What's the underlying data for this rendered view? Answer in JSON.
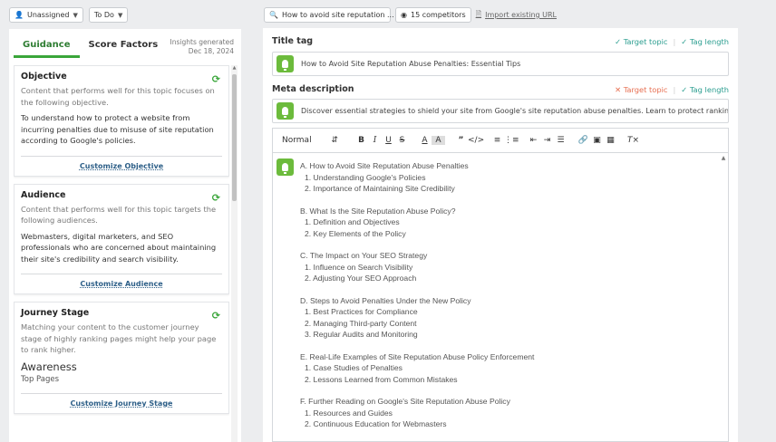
{
  "topbar": {
    "assignee": "Unassigned",
    "status": "To Do",
    "search_query": "How to avoid site reputation ...",
    "competitors": "15 competitors",
    "import_label": "Import existing URL"
  },
  "left_panel": {
    "tabs": [
      "Guidance",
      "Score Factors"
    ],
    "insights_line1": "Insights generated",
    "insights_line2": "Dec 18, 2024",
    "objective": {
      "title": "Objective",
      "intro": "Content that performs well for this topic focuses on the following objective.",
      "body": "To understand how to protect a website from incurring penalties due to misuse of site reputation according to Google's policies.",
      "cta": "Customize Objective"
    },
    "audience": {
      "title": "Audience",
      "intro": "Content that performs well for this topic targets the following audiences.",
      "body": "Webmasters, digital marketers, and SEO professionals who are concerned about maintaining their site's credibility and search visibility.",
      "cta": "Customize Audience"
    },
    "journey": {
      "title": "Journey Stage",
      "intro": "Matching your content to the customer journey stage of highly ranking pages might help your page to rank higher.",
      "stage": "Awareness",
      "sub": "Top Pages",
      "cta": "Customize Journey Stage"
    }
  },
  "right_panel": {
    "title_label": "Title tag",
    "title_value": "How to Avoid Site Reputation Abuse Penalties: Essential Tips",
    "title_checks": [
      "Target topic",
      "Tag length"
    ],
    "meta_label": "Meta description",
    "meta_value": "Discover essential strategies to shield your site from Google's site reputation abuse penalties. Learn to protect rankings and",
    "meta_checks": [
      "Target topic",
      "Tag length"
    ],
    "toolbar_heading": "Normal",
    "outline": [
      {
        "h": "A. How to Avoid Site Reputation Abuse Penalties",
        "items": [
          "1. Understanding Google's Policies",
          "2. Importance of Maintaining Site Credibility"
        ]
      },
      {
        "h": "B. What Is the Site Reputation Abuse Policy?",
        "items": [
          "1. Definition and Objectives",
          "2. Key Elements of the Policy"
        ]
      },
      {
        "h": "C. The Impact on Your SEO Strategy",
        "items": [
          "1. Influence on Search Visibility",
          "2. Adjusting Your SEO Approach"
        ]
      },
      {
        "h": "D. Steps to Avoid Penalties Under the New Policy",
        "items": [
          "1. Best Practices for Compliance",
          "2. Managing Third-party Content",
          "3. Regular Audits and Monitoring"
        ]
      },
      {
        "h": "E. Real-Life Examples of Site Reputation Abuse Policy Enforcement",
        "items": [
          "1. Case Studies of Penalties",
          "2. Lessons Learned from Common Mistakes"
        ]
      },
      {
        "h": "F. Further Reading on Google's Site Reputation Abuse Policy",
        "items": [
          "1. Resources and Guides",
          "2. Continuous Education for Webmasters"
        ]
      }
    ]
  },
  "colors": {
    "accent_green": "#3aa63a",
    "ok_teal": "#2a9d8f",
    "error_orange": "#e76f51",
    "link_blue": "#2d5f88"
  }
}
